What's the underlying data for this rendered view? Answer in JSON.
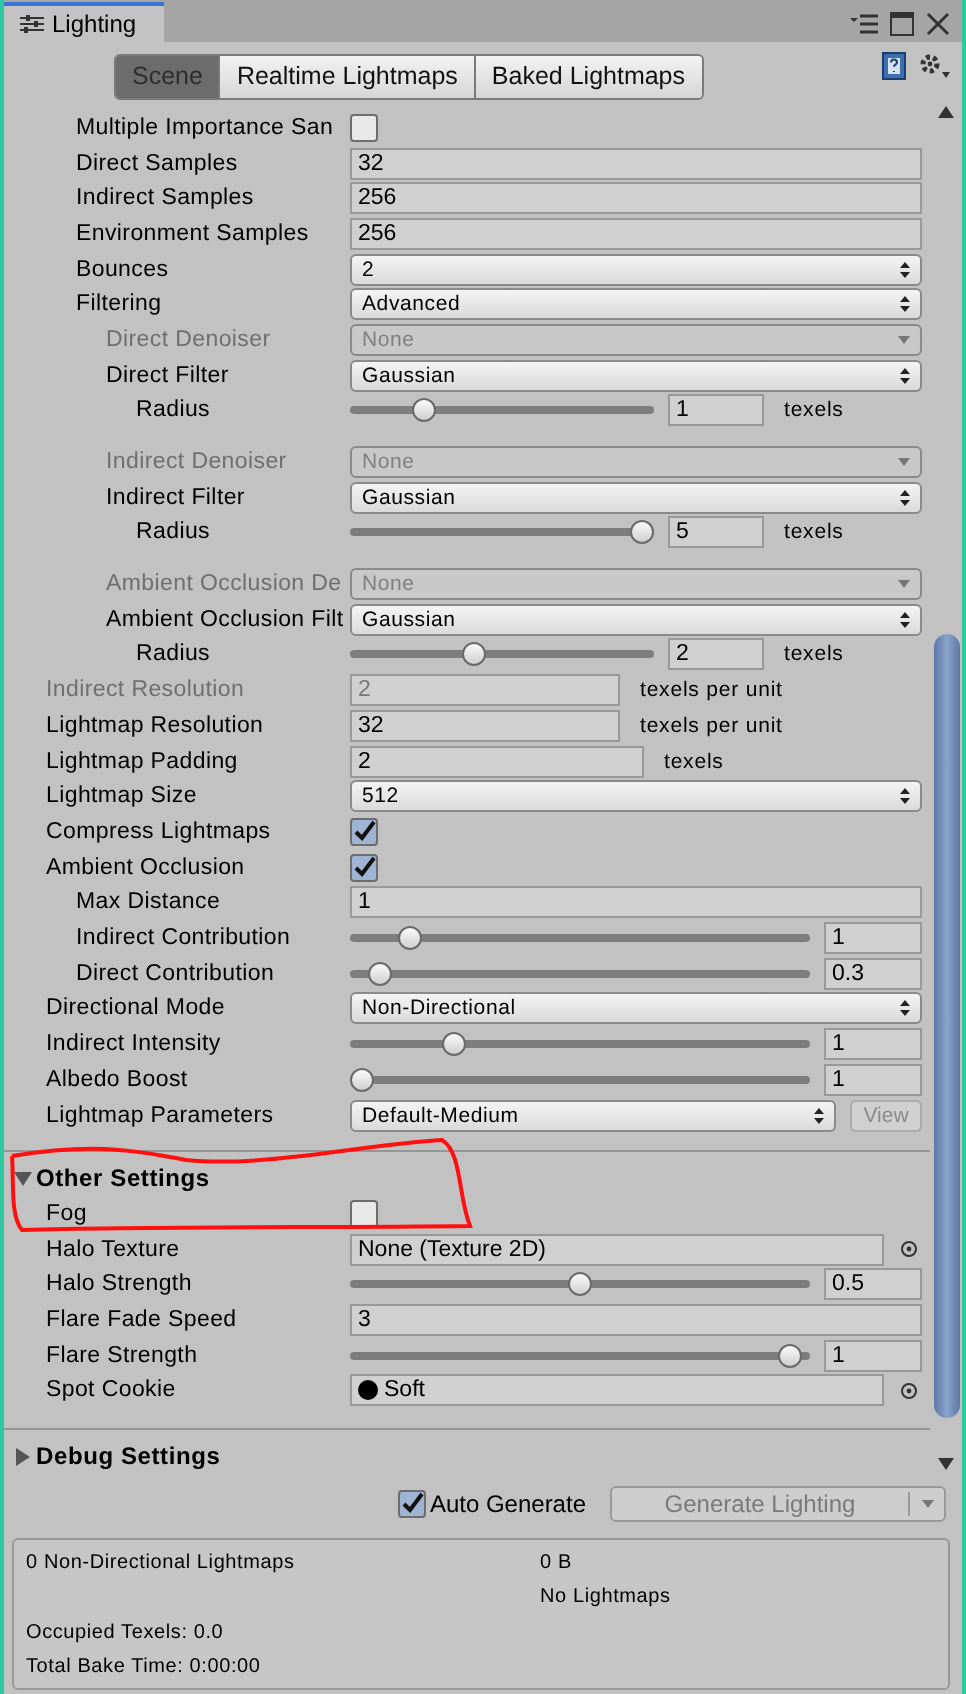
{
  "window": {
    "title": "Lighting"
  },
  "tabs": [
    {
      "label": "Scene",
      "selected": true
    },
    {
      "label": "Realtime Lightmaps",
      "selected": false
    },
    {
      "label": "Baked Lightmaps",
      "selected": false
    }
  ],
  "lightmapper_rows": [
    {
      "kind": "checkbox",
      "label": "Multiple Importance San",
      "checked": false
    },
    {
      "kind": "field",
      "label": "Direct Samples",
      "value": "32"
    },
    {
      "kind": "field",
      "label": "Indirect Samples",
      "value": "256"
    },
    {
      "kind": "field",
      "label": "Environment Samples",
      "value": "256"
    },
    {
      "kind": "dropdown",
      "label": "Bounces",
      "value": "2"
    },
    {
      "kind": "dropdown",
      "label": "Filtering",
      "value": "Advanced",
      "children": [
        {
          "kind": "dropdown",
          "label": "Direct Denoiser",
          "value": "None",
          "disabled": true
        },
        {
          "kind": "dropdown",
          "label": "Direct Filter",
          "value": "Gaussian",
          "children": [
            {
              "kind": "slider",
              "label": "Radius",
              "level": 0.22,
              "value": "1",
              "unit": "texels"
            }
          ]
        },
        {
          "kind": "dropdown",
          "label": "Indirect Denoiser",
          "value": "None",
          "disabled": true
        },
        {
          "kind": "dropdown",
          "label": "Indirect Filter",
          "value": "Gaussian",
          "children": [
            {
              "kind": "slider",
              "label": "Radius",
              "level": 1,
              "value": "5",
              "unit": "texels"
            }
          ]
        },
        {
          "kind": "dropdown",
          "label": "Ambient Occlusion De",
          "value": "None",
          "disabled": true
        },
        {
          "kind": "dropdown",
          "label": "Ambient Occlusion Filt",
          "value": "Gaussian",
          "children": [
            {
              "kind": "slider",
              "label": "Radius",
              "level": 0.4,
              "value": "2",
              "unit": "texels"
            }
          ]
        }
      ]
    }
  ],
  "rows": [
    {
      "kind": "field",
      "label": "Indirect Resolution",
      "value": "2",
      "unit": "texels per unit",
      "disabled": true
    },
    {
      "kind": "field",
      "label": "Lightmap Resolution",
      "value": "32",
      "unit": "texels per unit"
    },
    {
      "kind": "field",
      "label": "Lightmap Padding",
      "value": "2",
      "unit": "texels"
    },
    {
      "kind": "dropdown",
      "label": "Lightmap Size",
      "value": "512"
    },
    {
      "kind": "checkbox",
      "label": "Compress Lightmaps",
      "checked": true
    },
    {
      "kind": "checkbox",
      "label": "Ambient Occlusion",
      "checked": true,
      "children": [
        {
          "kind": "field",
          "label": "Max Distance",
          "value": "1"
        },
        {
          "kind": "slider",
          "label": "Indirect Contribution",
          "level": 0.11,
          "value": "1"
        },
        {
          "kind": "slider",
          "label": "Direct Contribution",
          "level": 0.04,
          "value": "0.3"
        }
      ]
    },
    {
      "kind": "dropdown",
      "label": "Directional Mode",
      "value": "Non-Directional"
    },
    {
      "kind": "slider",
      "label": "Indirect Intensity",
      "level": 0.21,
      "value": "1"
    },
    {
      "kind": "slider",
      "label": "Albedo Boost",
      "level": 0,
      "value": "1"
    },
    {
      "kind": "dropdown",
      "label": "Lightmap Parameters",
      "value": "Default-Medium",
      "button": "View"
    }
  ],
  "other_settings": {
    "title": "Other Settings",
    "expanded": true,
    "rows": [
      {
        "kind": "checkbox",
        "label": "Fog",
        "checked": false
      },
      {
        "kind": "object",
        "label": "Halo Texture",
        "value": "None (Texture 2D)"
      },
      {
        "kind": "slider",
        "label": "Halo Strength",
        "level": 0.5,
        "value": "0.5"
      },
      {
        "kind": "field",
        "label": "Flare Fade Speed",
        "value": "3"
      },
      {
        "kind": "slider",
        "label": "Flare Strength",
        "level": 0.98,
        "value": "1"
      },
      {
        "kind": "object",
        "label": "Spot Cookie",
        "value": "Soft",
        "thumbnail": true
      }
    ]
  },
  "debug_settings": {
    "title": "Debug Settings",
    "expanded": false
  },
  "auto_generate": {
    "label": "Auto Generate",
    "checked": true
  },
  "generate_button": {
    "label": "Generate Lighting",
    "disabled": true
  },
  "stats": {
    "lightmaps": "0 Non-Directional Lightmaps",
    "size": "0 B",
    "note": "No Lightmaps",
    "occupied": "Occupied Texels: 0.0",
    "bake_time": "Total Bake Time: 0:00:00"
  }
}
